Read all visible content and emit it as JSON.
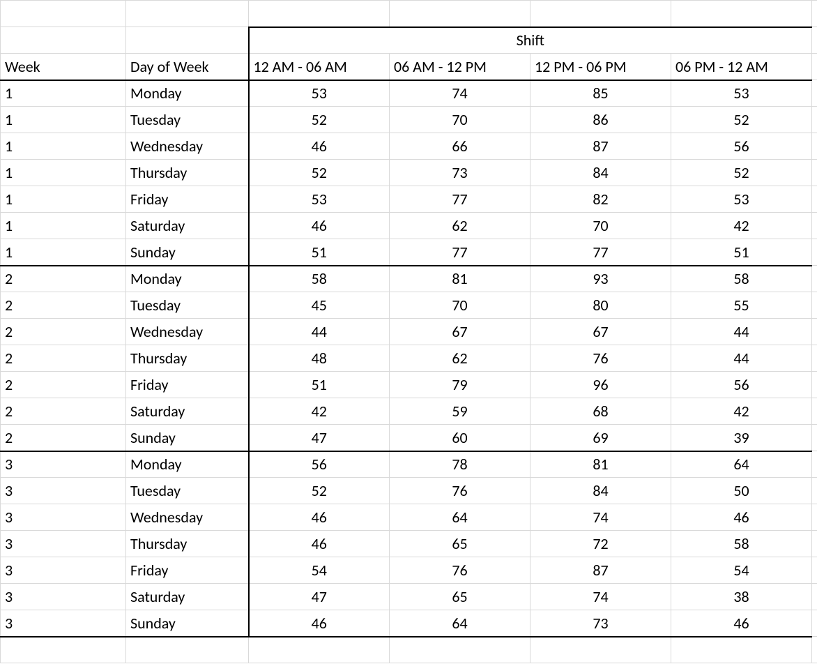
{
  "chart_data": {
    "type": "table",
    "title": "Shift",
    "row_key_columns": [
      "Week",
      "Day of Week"
    ],
    "columns": [
      "12 AM - 06 AM",
      "06 AM - 12 PM",
      "12 PM - 06 PM",
      "06 PM - 12 AM"
    ],
    "rows": [
      {
        "week": "1",
        "day": "Monday",
        "values": [
          53,
          74,
          85,
          53
        ]
      },
      {
        "week": "1",
        "day": "Tuesday",
        "values": [
          52,
          70,
          86,
          52
        ]
      },
      {
        "week": "1",
        "day": "Wednesday",
        "values": [
          46,
          66,
          87,
          56
        ]
      },
      {
        "week": "1",
        "day": "Thursday",
        "values": [
          52,
          73,
          84,
          52
        ]
      },
      {
        "week": "1",
        "day": "Friday",
        "values": [
          53,
          77,
          82,
          53
        ]
      },
      {
        "week": "1",
        "day": "Saturday",
        "values": [
          46,
          62,
          70,
          42
        ]
      },
      {
        "week": "1",
        "day": "Sunday",
        "values": [
          51,
          77,
          77,
          51
        ]
      },
      {
        "week": "2",
        "day": "Monday",
        "values": [
          58,
          81,
          93,
          58
        ]
      },
      {
        "week": "2",
        "day": "Tuesday",
        "values": [
          45,
          70,
          80,
          55
        ]
      },
      {
        "week": "2",
        "day": "Wednesday",
        "values": [
          44,
          67,
          67,
          44
        ]
      },
      {
        "week": "2",
        "day": "Thursday",
        "values": [
          48,
          62,
          76,
          44
        ]
      },
      {
        "week": "2",
        "day": "Friday",
        "values": [
          51,
          79,
          96,
          56
        ]
      },
      {
        "week": "2",
        "day": "Saturday",
        "values": [
          42,
          59,
          68,
          42
        ]
      },
      {
        "week": "2",
        "day": "Sunday",
        "values": [
          47,
          60,
          69,
          39
        ]
      },
      {
        "week": "3",
        "day": "Monday",
        "values": [
          56,
          78,
          81,
          64
        ]
      },
      {
        "week": "3",
        "day": "Tuesday",
        "values": [
          52,
          76,
          84,
          50
        ]
      },
      {
        "week": "3",
        "day": "Wednesday",
        "values": [
          46,
          64,
          74,
          46
        ]
      },
      {
        "week": "3",
        "day": "Thursday",
        "values": [
          46,
          65,
          72,
          58
        ]
      },
      {
        "week": "3",
        "day": "Friday",
        "values": [
          54,
          76,
          87,
          54
        ]
      },
      {
        "week": "3",
        "day": "Saturday",
        "values": [
          47,
          65,
          74,
          38
        ]
      },
      {
        "week": "3",
        "day": "Sunday",
        "values": [
          46,
          64,
          73,
          46
        ]
      }
    ]
  },
  "headers": {
    "shift_title": "Shift",
    "week": "Week",
    "day_of_week": "Day of Week",
    "shift1": "12 AM - 06 AM",
    "shift2": "06 AM - 12 PM",
    "shift3": "12 PM - 06 PM",
    "shift4": "06 PM - 12 AM"
  }
}
